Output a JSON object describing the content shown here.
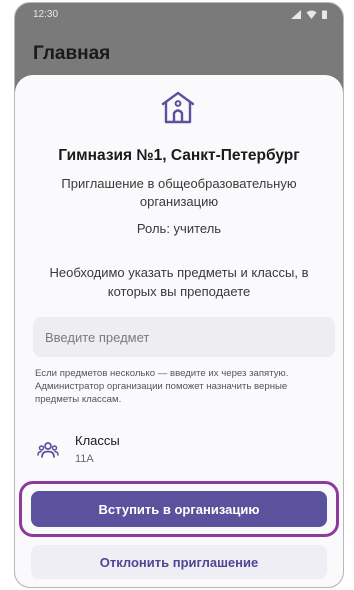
{
  "status_bar": {
    "time": "12:30",
    "icons": [
      "signal-icon",
      "wifi-icon",
      "battery-icon"
    ]
  },
  "app_bar": {
    "title": "Главная"
  },
  "invite": {
    "icon": "school-building-icon",
    "org_name": "Гимназия №1, Санкт-Петербург",
    "invite_text": "Приглашение в общеобразовательную организацию",
    "role": "Роль: учитель",
    "instruction": "Необходимо указать предметы и классы, в которых вы преподаете"
  },
  "subject_input": {
    "placeholder": "Введите предмет",
    "value": ""
  },
  "hint": "Если предметов несколько — введите их через запятую. Администратор организации поможет назначить верные предметы классам.",
  "classes": {
    "icon": "people-icon",
    "label": "Классы",
    "value": "11А"
  },
  "buttons": {
    "join": "Вступить в организацию",
    "decline": "Отклонить приглашение"
  },
  "colors": {
    "primary": "#5b529e",
    "highlight_outline": "#8d3a9b",
    "scrim": "#7a7a7a",
    "sheet": "#fafafc"
  }
}
